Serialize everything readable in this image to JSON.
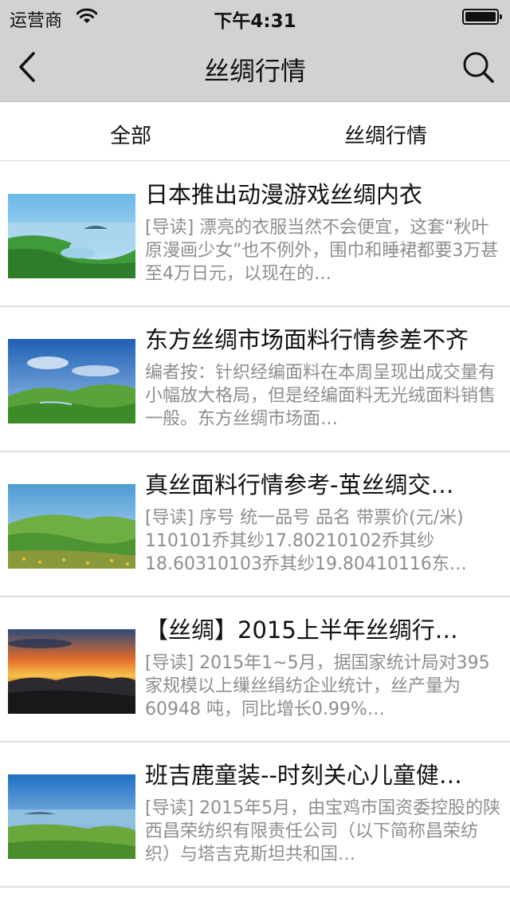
{
  "status_bar": {
    "carrier": "运营商",
    "time": "下午4:31",
    "wifi_icon": "wifi-icon",
    "battery_icon": "battery-icon",
    "battery_level": 1.0
  },
  "nav": {
    "title": "丝绸行情",
    "back_icon": "chevron-left-icon",
    "search_icon": "search-icon"
  },
  "tabs": [
    {
      "label": "全部"
    },
    {
      "label": "丝绸行情"
    }
  ],
  "news": [
    {
      "title": "日本推出动漫游戏丝绸内衣",
      "summary": "[导读] 漂亮的衣服当然不会便宜，这套“秋叶原漫画少女”也不例外，围巾和睡裙都要3万甚至4万日元，以现在的…",
      "image": "landscape-lake-hills"
    },
    {
      "title": "东方丝绸市场面料行情参差不齐",
      "summary": "编者按：针织经编面料在本周呈现出成交量有小幅放大格局，但是经编面料无光绒面料销售一般。东方丝绸市场面…",
      "image": "landscape-green-hills-blue-sky"
    },
    {
      "title": "真丝面料行情参考-茧丝绸交…",
      "summary": "[导读] 序号 统一品号 品名 带票价(元/米) 110101乔其纱17.80210102乔其纱18.60310103乔其纱19.80410116东…",
      "image": "landscape-meadow-flowers"
    },
    {
      "title": "【丝绸】2015上半年丝绸行…",
      "summary": "[导读] 2015年1~5月，据国家统计局对395家规模以上缫丝绢纺企业统计，丝产量为60948 吨，同比增长0.99%…",
      "image": "landscape-sunset-mountains"
    },
    {
      "title": "班吉鹿童装--时刻关心儿童健…",
      "summary": "[导读] 2015年5月，由宝鸡市国资委控股的陕西昌荣纺织有限责任公司（以下简称昌荣纺织）与塔吉克斯坦共和国…",
      "image": "landscape-coastal-hills"
    }
  ]
}
